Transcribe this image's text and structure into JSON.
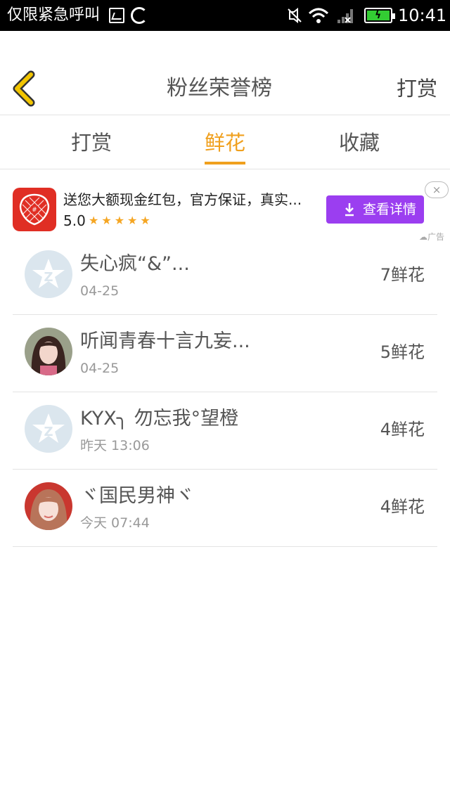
{
  "status_bar": {
    "carrier": "仅限紧急呼叫",
    "time": "10:41",
    "icons": [
      "image-icon",
      "sync-icon",
      "mute-icon",
      "wifi-icon",
      "signal-icon",
      "battery-icon"
    ]
  },
  "header": {
    "title": "粉丝荣誉榜",
    "right_label": "打赏",
    "back_icon": "chevron-left-icon"
  },
  "tabs": [
    {
      "label": "打赏",
      "active": false
    },
    {
      "label": "鲜花",
      "active": true
    },
    {
      "label": "收藏",
      "active": false
    }
  ],
  "ad": {
    "text": "送您大额现金红包，官方保证，真实...",
    "rating": "5.0",
    "stars": "★★★★★",
    "button_label": "查看详情",
    "close_label": "×",
    "ad_label": "广告"
  },
  "list": [
    {
      "name": "失心疯“&”...",
      "time": "04-25",
      "count": "7鲜花",
      "avatar": "default"
    },
    {
      "name": "听闻青春十言九妄...",
      "time": "04-25",
      "count": "5鲜花",
      "avatar": "photo"
    },
    {
      "name": "KYX╮ 勿忘我°望橙",
      "time": "昨天 13:06",
      "count": "4鲜花",
      "avatar": "default"
    },
    {
      "name": "ヾ国民男神ヾ",
      "time": "今天 07:44",
      "count": "4鲜花",
      "avatar": "photo"
    }
  ],
  "colors": {
    "accent": "#f0a01e",
    "ad_button": "#9b3ef0",
    "ad_logo": "#e02e24",
    "back_icon": "#f2c500"
  }
}
